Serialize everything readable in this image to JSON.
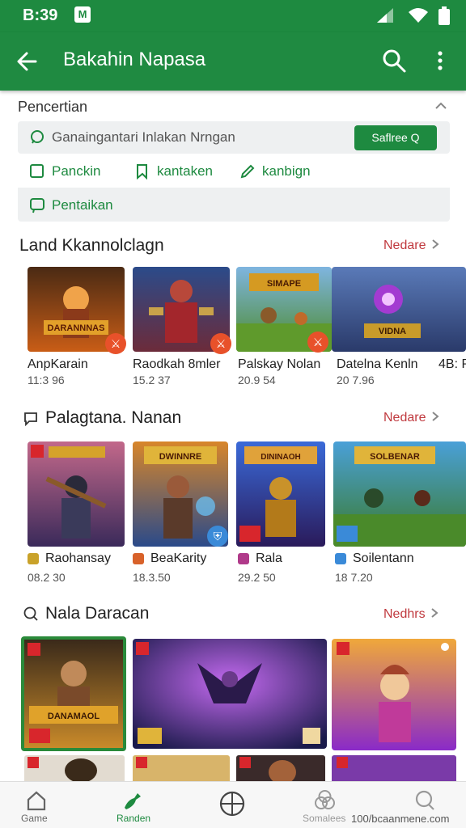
{
  "status_bar": {
    "time": "B:39",
    "notif_glyph": "M"
  },
  "app_bar": {
    "title": "Bakahin Napasa"
  },
  "filter": {
    "title": "Pencertian",
    "search_text": "Ganaingantari Inlakan Nrngan",
    "search_button": "Saflree Q",
    "chips": [
      "Panckin",
      "kantaken",
      "kanbign"
    ],
    "chip_second_row": "Pentaikan"
  },
  "sections": [
    {
      "title": "Land Kkannolclagn",
      "link": "Nedare",
      "cards": [
        {
          "name": "AnpKarain",
          "meta": "11:3 96",
          "banner": "DARANNNAS"
        },
        {
          "name": "Raodkah 8mler",
          "meta": "15.2 37",
          "banner": ""
        },
        {
          "name": "Palskay Nolan",
          "meta": "20.9 54",
          "banner": "SIMAPE"
        },
        {
          "name": "Datelna Kenln",
          "meta": "20 7.96",
          "banner": "VIDNA"
        },
        {
          "name": "4B: P",
          "meta": "",
          "banner": ""
        }
      ]
    },
    {
      "title": "Palagtana. Nanan",
      "link": "Nedare",
      "cards": [
        {
          "name": "Raohansay",
          "meta": "08.2 30",
          "banner": ""
        },
        {
          "name": "BeaKarity",
          "meta": "18.3.50",
          "banner": "DWINNRE"
        },
        {
          "name": "Rala",
          "meta": "29.2 50",
          "banner": "DININAOH"
        },
        {
          "name": "Soilentann",
          "meta": "18 7.20",
          "banner": "SOLBENAR"
        }
      ]
    },
    {
      "title": "Nala Daracan",
      "link": "Nedhrs",
      "cards": [
        {
          "name": "",
          "meta": "",
          "banner": "DANAMAOL"
        },
        {
          "name": "",
          "meta": "",
          "banner": ""
        },
        {
          "name": "",
          "meta": "",
          "banner": ""
        }
      ]
    }
  ],
  "bottom_nav": [
    {
      "label": "Game",
      "icon": "home-icon"
    },
    {
      "label": "Randen",
      "icon": "joystick-icon"
    },
    {
      "label": "",
      "icon": "add-circle-icon"
    },
    {
      "label": "Somalees",
      "icon": "circles-icon"
    },
    {
      "label": "100/bcaanmene.com",
      "icon": "search-circle-icon"
    }
  ],
  "colors": {
    "brand": "#1e8a40",
    "accent": "#c0393e"
  }
}
